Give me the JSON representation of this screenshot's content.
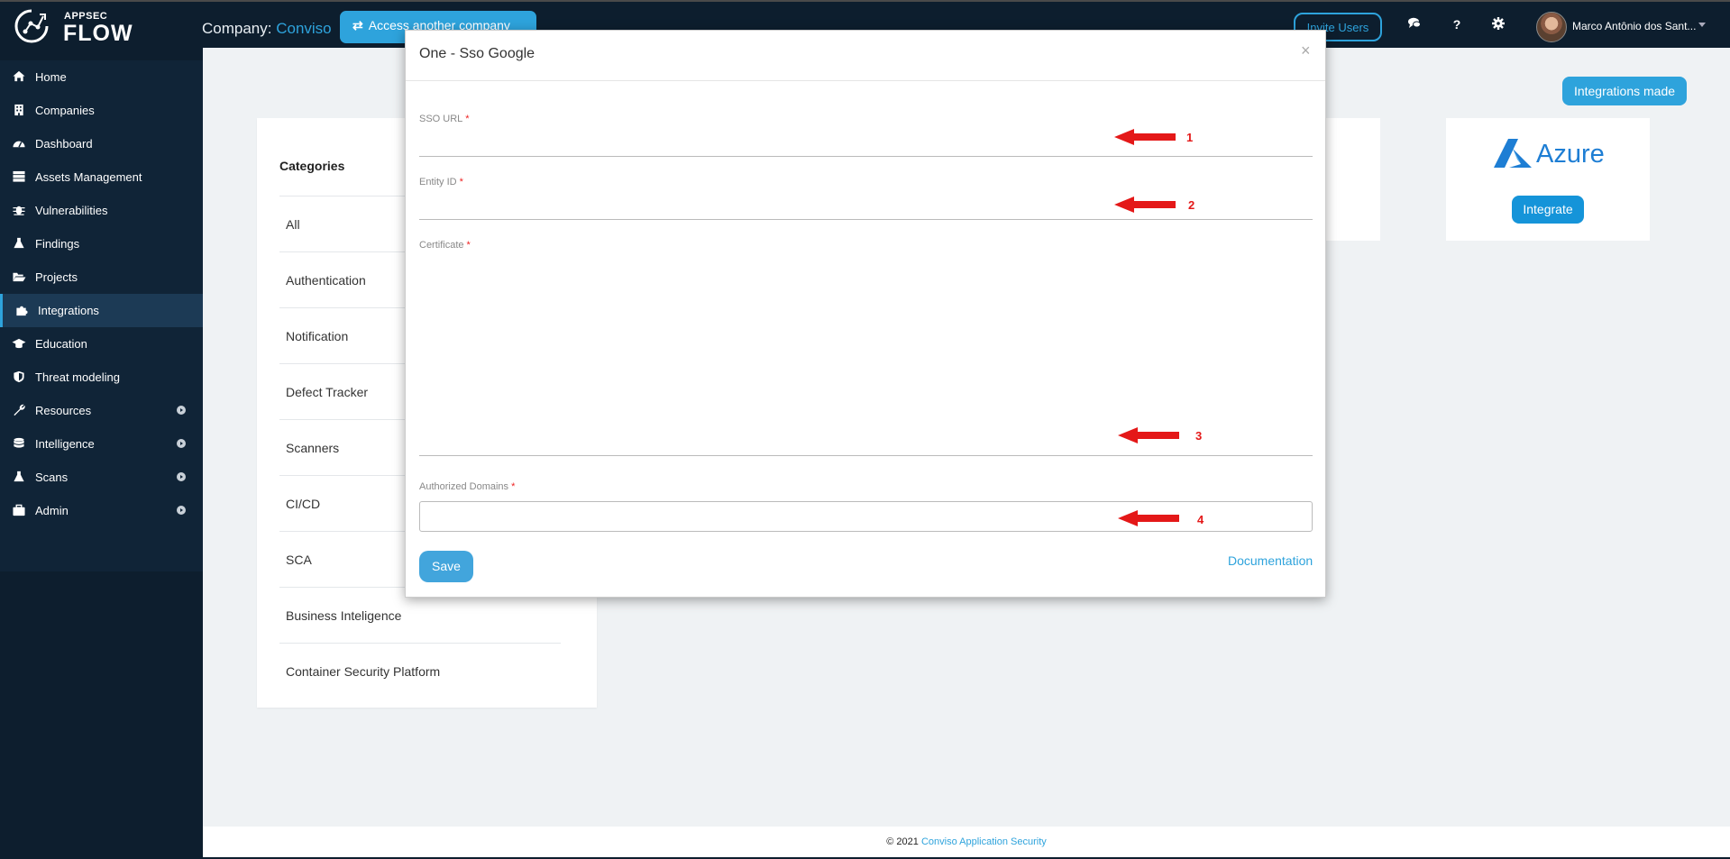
{
  "brand": {
    "small": "APPSEC",
    "big": "FLOW"
  },
  "header": {
    "company_label": "Company:",
    "company_name": "Conviso",
    "access_button": "Access another company",
    "invite_button": "Invite Users",
    "help_icon": "?",
    "user_name": "Marco Antônio dos Sant..."
  },
  "sidebar": {
    "items": [
      {
        "label": "Home",
        "icon": "home-icon"
      },
      {
        "label": "Companies",
        "icon": "building-icon"
      },
      {
        "label": "Dashboard",
        "icon": "gauge-icon"
      },
      {
        "label": "Assets Management",
        "icon": "server-icon"
      },
      {
        "label": "Vulnerabilities",
        "icon": "bug-icon"
      },
      {
        "label": "Findings",
        "icon": "flask-icon"
      },
      {
        "label": "Projects",
        "icon": "folder-open-icon"
      },
      {
        "label": "Integrations",
        "icon": "puzzle-icon",
        "active": true
      },
      {
        "label": "Education",
        "icon": "graduation-cap-icon"
      },
      {
        "label": "Threat modeling",
        "icon": "shield-icon"
      },
      {
        "label": "Resources",
        "icon": "wrench-icon",
        "expandable": true
      },
      {
        "label": "Intelligence",
        "icon": "database-icon",
        "expandable": true
      },
      {
        "label": "Scans",
        "icon": "flask-icon",
        "expandable": true
      },
      {
        "label": "Admin",
        "icon": "briefcase-icon",
        "expandable": true
      }
    ]
  },
  "main": {
    "integrations_made_button": "Integrations made",
    "categories": {
      "title": "Categories",
      "items": [
        "All",
        "Authentication",
        "Notification",
        "Defect Tracker",
        "Scanners",
        "CI/CD",
        "SCA",
        "Business Inteligence",
        "Container Security Platform"
      ]
    },
    "azure_card": {
      "logo_text": "Azure",
      "button": "Integrate"
    }
  },
  "modal": {
    "title": "One - Sso Google",
    "close": "×",
    "fields": {
      "sso_url": {
        "label": "SSO URL",
        "value": ""
      },
      "entity_id": {
        "label": "Entity ID",
        "value": ""
      },
      "certificate": {
        "label": "Certificate",
        "value": ""
      },
      "authorized_domains": {
        "label": "Authorized Domains",
        "value": ""
      }
    },
    "required_marker": "*",
    "save_button": "Save",
    "documentation_link": "Documentation"
  },
  "annotations": [
    "1",
    "2",
    "3",
    "4"
  ],
  "footer": {
    "copyright": "© 2021",
    "link": "Conviso Application Security"
  },
  "colors": {
    "accent": "#2ea3dc",
    "sidebar_bg": "#0d1e2e",
    "annotation_red": "#e41818",
    "azure_blue": "#1e7ed4"
  }
}
